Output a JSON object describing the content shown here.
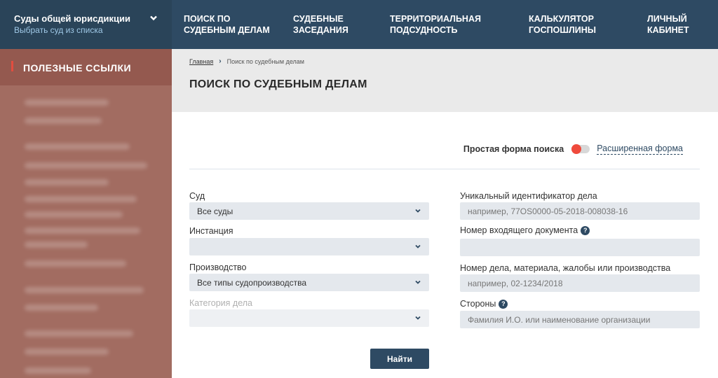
{
  "header": {
    "court_title": "Суды общей юрисдикции",
    "court_subtitle": "Выбрать суд из списка",
    "nav": [
      {
        "line1": "Поиск по",
        "line2": "судебным делам"
      },
      {
        "line1": "Судебные",
        "line2": "заседания"
      },
      {
        "line1": "Территориальная",
        "line2": "подсудность"
      },
      {
        "line1": "Калькулятор",
        "line2": "госпошлины"
      },
      {
        "line1": "Личный",
        "line2": "кабинет"
      }
    ]
  },
  "sidebar": {
    "title": "ПОЛЕЗНЫЕ ССЫЛКИ"
  },
  "breadcrumb": {
    "home": "Главная",
    "current": "Поиск по судебным делам"
  },
  "page_title": "Поиск по судебным делам",
  "search_mode": {
    "simple_label": "Простая форма поиска",
    "advanced_label": "Расширенная форма",
    "active": "simple"
  },
  "form": {
    "court": {
      "label": "Суд",
      "value": "Все суды"
    },
    "instance": {
      "label": "Инстанция",
      "value": ""
    },
    "proceeding": {
      "label": "Производство",
      "value": "Все типы судопроизводства"
    },
    "category": {
      "label": "Категория дела",
      "value": ""
    },
    "uid": {
      "label": "Уникальный идентификатор дела",
      "placeholder": "например, 77OS0000-05-2018-008038-16"
    },
    "incoming_doc": {
      "label": "Номер входящего документа",
      "placeholder": ""
    },
    "case_number": {
      "label": "Номер дела, материала, жалобы или производства",
      "placeholder": "например, 02-1234/2018"
    },
    "parties": {
      "label": "Стороны",
      "placeholder": "Фамилия И.О. или наименование организации"
    },
    "help_glyph": "?",
    "submit_label": "Найти"
  },
  "colors": {
    "header": "#2e4a63",
    "sidebar": "#a26c61",
    "accent": "#ef4a3c"
  }
}
